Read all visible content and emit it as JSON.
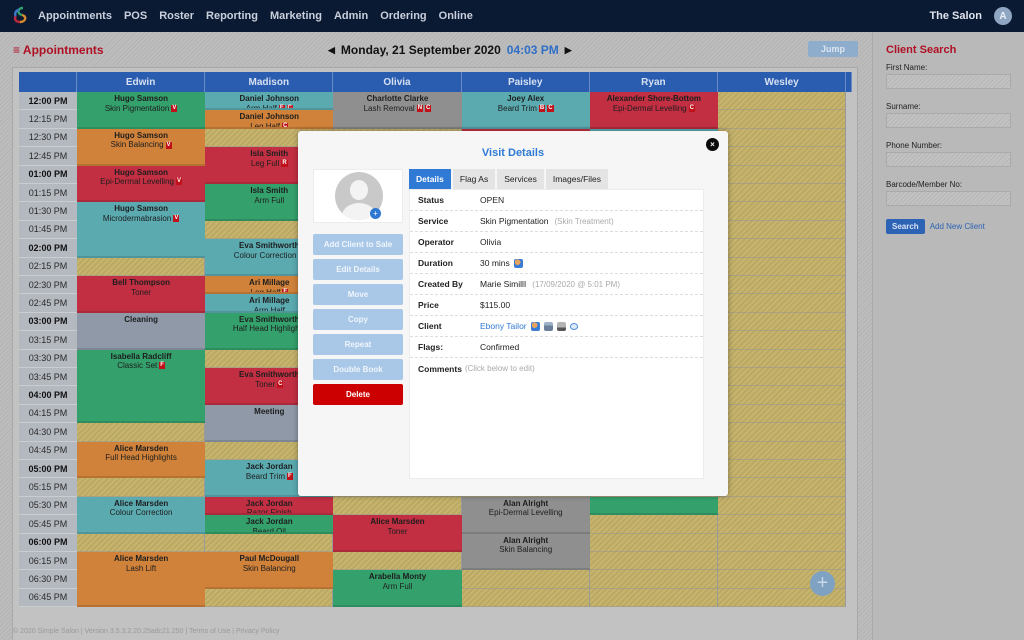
{
  "nav": {
    "items": [
      "Appointments",
      "POS",
      "Roster",
      "Reporting",
      "Marketing",
      "Admin",
      "Ordering",
      "Online"
    ],
    "salon_name": "The Salon",
    "avatar_initial": "A"
  },
  "page": {
    "title": "Appointments",
    "menu_icon": "≡",
    "date": "Monday, 21 September 2020",
    "time": "04:03 PM",
    "prev_icon": "◀",
    "next_icon": "▶",
    "jump_label": "Jump"
  },
  "calendar": {
    "staff": [
      "Edwin",
      "Madison",
      "Olivia",
      "Paisley",
      "Ryan",
      "Wesley"
    ],
    "times": [
      "12:00 PM",
      "12:15 PM",
      "12:30 PM",
      "12:45 PM",
      "01:00 PM",
      "01:15 PM",
      "01:30 PM",
      "01:45 PM",
      "02:00 PM",
      "02:15 PM",
      "02:30 PM",
      "02:45 PM",
      "03:00 PM",
      "03:15 PM",
      "03:30 PM",
      "03:45 PM",
      "04:00 PM",
      "04:15 PM",
      "04:30 PM",
      "04:45 PM",
      "05:00 PM",
      "05:15 PM",
      "05:30 PM",
      "05:45 PM",
      "06:00 PM",
      "06:15 PM",
      "06:30 PM",
      "06:45 PM"
    ],
    "appointments": [
      {
        "col": 0,
        "start": 0,
        "slots": 2,
        "color": "green",
        "client": "Hugo Samson",
        "service": "Skin Pigmentation",
        "flags": [
          "V"
        ]
      },
      {
        "col": 0,
        "start": 2,
        "slots": 2,
        "color": "orange",
        "client": "Hugo Samson",
        "service": "Skin Balancing",
        "flags": [
          "V"
        ]
      },
      {
        "col": 0,
        "start": 4,
        "slots": 2,
        "color": "red",
        "client": "Hugo Samson",
        "service": "Epi-Dermal Levelling",
        "flags": [
          "V"
        ]
      },
      {
        "col": 0,
        "start": 6,
        "slots": 3,
        "color": "teal",
        "client": "Hugo Samson",
        "service": "Microdermabrasion",
        "flags": [
          "V"
        ]
      },
      {
        "col": 0,
        "start": 10,
        "slots": 2,
        "color": "red",
        "client": "Bell Thompson",
        "service": "Toner",
        "flags": []
      },
      {
        "col": 0,
        "start": 12,
        "slots": 2,
        "color": "grey",
        "client": "Cleaning",
        "service": "",
        "flags": []
      },
      {
        "col": 0,
        "start": 14,
        "slots": 4,
        "color": "green",
        "client": "Isabella Radcliff",
        "service": "Classic Set",
        "flags": [
          "F"
        ]
      },
      {
        "col": 0,
        "start": 19,
        "slots": 2,
        "color": "orange",
        "client": "Alice Marsden",
        "service": "Full Head Highlights",
        "flags": []
      },
      {
        "col": 0,
        "start": 22,
        "slots": 2,
        "color": "teal",
        "client": "Alice Marsden",
        "service": "Colour Correction",
        "flags": []
      },
      {
        "col": 0,
        "start": 25,
        "slots": 3,
        "color": "orange",
        "client": "Alice Marsden",
        "service": "Lash Lift",
        "flags": []
      },
      {
        "col": 1,
        "start": 0,
        "slots": 1,
        "color": "teal",
        "client": "Daniel Johnson",
        "service": "Arm Half",
        "flags": [
          "F",
          "C"
        ]
      },
      {
        "col": 1,
        "start": 1,
        "slots": 1,
        "color": "orange",
        "client": "Daniel Johnson",
        "service": "Leg Half",
        "flags": [
          "C"
        ]
      },
      {
        "col": 1,
        "start": 3,
        "slots": 2,
        "color": "red",
        "client": "Isla Smith",
        "service": "Leg Full",
        "flags": [
          "R"
        ]
      },
      {
        "col": 1,
        "start": 5,
        "slots": 2,
        "color": "green",
        "client": "Isla Smith",
        "service": "Arm Full",
        "flags": []
      },
      {
        "col": 1,
        "start": 8,
        "slots": 2,
        "color": "teal",
        "client": "Eva Smithworth",
        "service": "Colour Correction",
        "flags": [
          "C"
        ]
      },
      {
        "col": 1,
        "start": 10,
        "slots": 1,
        "color": "orange",
        "client": "Ari Millage",
        "service": "Leg Half",
        "flags": [
          "F"
        ]
      },
      {
        "col": 1,
        "start": 11,
        "slots": 1,
        "color": "teal",
        "client": "Ari Millage",
        "service": "Arm Half",
        "flags": []
      },
      {
        "col": 1,
        "start": 12,
        "slots": 2,
        "color": "green",
        "client": "Eva Smithworth",
        "service": "Half Head Highlights",
        "flags": []
      },
      {
        "col": 1,
        "start": 15,
        "slots": 2,
        "color": "red",
        "client": "Eva Smithworth",
        "service": "Toner",
        "flags": [
          "C"
        ]
      },
      {
        "col": 1,
        "start": 17,
        "slots": 2,
        "color": "grey",
        "client": "Meeting",
        "service": "",
        "flags": []
      },
      {
        "col": 1,
        "start": 20,
        "slots": 2,
        "color": "teal",
        "client": "Jack Jordan",
        "service": "Beard Trim",
        "flags": [
          "F"
        ]
      },
      {
        "col": 1,
        "start": 22,
        "slots": 1,
        "color": "red",
        "client": "Jack Jordan",
        "service": "Razor Finish",
        "flags": []
      },
      {
        "col": 1,
        "start": 23,
        "slots": 1,
        "color": "green",
        "client": "Jack Jordan",
        "service": "Beard Oil",
        "flags": []
      },
      {
        "col": 1,
        "start": 25,
        "slots": 2,
        "color": "orange",
        "client": "Paul McDougall",
        "service": "Skin Balancing",
        "flags": []
      },
      {
        "col": 2,
        "start": 0,
        "slots": 2,
        "color": "dgrey",
        "client": "Charlotte Clarke",
        "service": "Lash Removal",
        "flags": [
          "N",
          "C"
        ]
      },
      {
        "col": 2,
        "start": 23,
        "slots": 2,
        "color": "red",
        "client": "Alice Marsden",
        "service": "Toner",
        "flags": []
      },
      {
        "col": 2,
        "start": 26,
        "slots": 2,
        "color": "green",
        "client": "Arabella Monty",
        "service": "Arm Full",
        "flags": []
      },
      {
        "col": 3,
        "start": 0,
        "slots": 2,
        "color": "teal",
        "client": "Joey Alex",
        "service": "Beard Trim",
        "flags": [
          "B",
          "C"
        ]
      },
      {
        "col": 3,
        "start": 2,
        "slots": 1,
        "color": "red",
        "client": "",
        "service": "",
        "flags": []
      },
      {
        "col": 3,
        "start": 22,
        "slots": 2,
        "color": "dgrey",
        "client": "Alan Alright",
        "service": "Epi-Dermal Levelling",
        "flags": []
      },
      {
        "col": 3,
        "start": 24,
        "slots": 2,
        "color": "dgrey",
        "client": "Alan Alright",
        "service": "Skin Balancing",
        "flags": []
      },
      {
        "col": 4,
        "start": 0,
        "slots": 2,
        "color": "red",
        "client": "Alexander Shore-Bottom",
        "service": "Epi-Dermal Levelling",
        "flags": [
          "C"
        ]
      },
      {
        "col": 4,
        "start": 2,
        "slots": 1,
        "color": "teal",
        "client": "",
        "service": "",
        "flags": []
      },
      {
        "col": 4,
        "start": 22,
        "slots": 1,
        "color": "green",
        "client": "",
        "service": "",
        "flags": []
      }
    ],
    "add_icon": "+"
  },
  "modal": {
    "title": "Visit Details",
    "close_icon": "×",
    "photo_add_icon": "+",
    "actions": [
      "Add Client to Sale",
      "Edit Details",
      "Move",
      "Copy",
      "Repeat",
      "Double Book",
      "Delete"
    ],
    "tabs": [
      "Details",
      "Flag As",
      "Services",
      "Images/Files"
    ],
    "active_tab": "Details",
    "details": {
      "status_label": "Status",
      "status": "OPEN",
      "service_label": "Service",
      "service": "Skin Pigmentation",
      "service_category": "(Skin Treatment)",
      "operator_label": "Operator",
      "operator": "Olivia",
      "duration_label": "Duration",
      "duration": "30 mins",
      "created_label": "Created By",
      "created_by": "Marie SimillI",
      "created_at": "(17/09/2020 @ 5:01 PM)",
      "price_label": "Price",
      "price": "$115.00",
      "client_label": "Client",
      "client": "Ebony Tailor",
      "flags_label": "Flags:",
      "flags": "Confirmed",
      "comments_label": "Comments",
      "comments_hint": "(Click below to edit)"
    }
  },
  "client_search": {
    "title": "Client Search",
    "first_name_label": "First Name:",
    "surname_label": "Surname:",
    "phone_label": "Phone Number:",
    "barcode_label": "Barcode/Member No:",
    "search_label": "Search",
    "add_new_label": "Add New Client"
  },
  "footer": {
    "copyright": "© 2020 Simple Salon | Version 3.5.3.2.20.25adc21.250 | ",
    "terms": "Terms of Use",
    "sep": " | ",
    "privacy": "Privacy Policy"
  }
}
